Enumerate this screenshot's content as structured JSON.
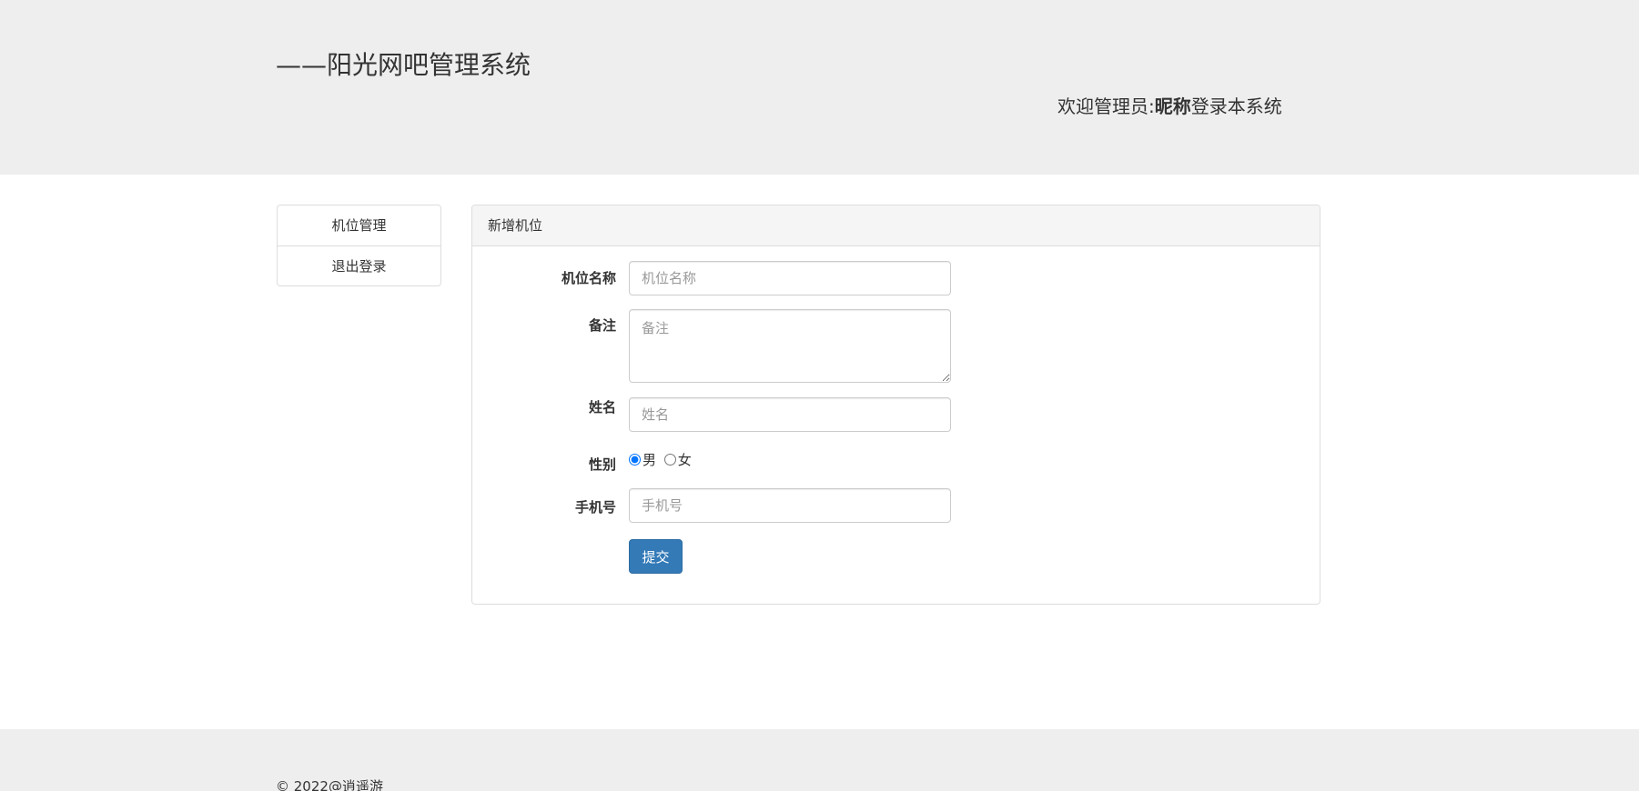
{
  "header": {
    "title": "——阳光网吧管理系统",
    "welcome_prefix": "欢迎管理员:",
    "nickname": "昵称",
    "welcome_suffix": "登录本系统"
  },
  "sidebar": {
    "items": [
      {
        "label": "机位管理"
      },
      {
        "label": "退出登录"
      }
    ]
  },
  "panel": {
    "title": "新增机位"
  },
  "form": {
    "machine_name": {
      "label": "机位名称",
      "placeholder": "机位名称",
      "value": ""
    },
    "remark": {
      "label": "备注",
      "placeholder": "备注",
      "value": ""
    },
    "name": {
      "label": "姓名",
      "placeholder": "姓名",
      "value": ""
    },
    "gender": {
      "label": "性别",
      "options": [
        {
          "label": "男",
          "checked": true
        },
        {
          "label": "女",
          "checked": false
        }
      ]
    },
    "phone": {
      "label": "手机号",
      "placeholder": "手机号",
      "value": ""
    },
    "submit_label": "提交"
  },
  "footer": {
    "copyright": "© 2022@逍遥游"
  },
  "colors": {
    "header_bg": "#eeeeee",
    "primary": "#337ab7",
    "border": "#dddddd"
  }
}
